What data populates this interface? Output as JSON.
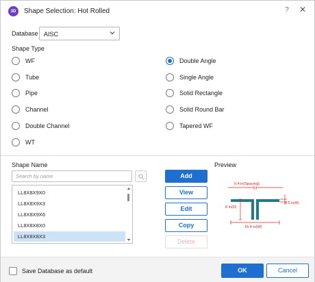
{
  "window": {
    "app_icon_text": "3D",
    "title": "Shape Selection: Hot Rolled",
    "help_label": "?",
    "close_label": "✕"
  },
  "database": {
    "label": "Database",
    "selected": "AISC"
  },
  "shape_type": {
    "label": "Shape Type",
    "options": [
      {
        "label": "WF",
        "checked": false
      },
      {
        "label": "Tube",
        "checked": false
      },
      {
        "label": "Pipe",
        "checked": false
      },
      {
        "label": "Channel",
        "checked": false
      },
      {
        "label": "Double Channel",
        "checked": false
      },
      {
        "label": "WT",
        "checked": false
      },
      {
        "label": "Double Angle",
        "checked": true
      },
      {
        "label": "Single Angle",
        "checked": false
      },
      {
        "label": "Solid Rectangle",
        "checked": false
      },
      {
        "label": "Solid Round Bar",
        "checked": false
      },
      {
        "label": "Tapered WF",
        "checked": false
      }
    ]
  },
  "shape_name": {
    "label": "Shape Name",
    "search_placeholder": "Search by name",
    "items": [
      "LL8X8X9X0",
      "LL8X8X9X3",
      "LL8X8X9X6",
      "LL8X8X8X0",
      "LL8X8X8X3"
    ],
    "selected_index": 4
  },
  "actions": {
    "add": "Add",
    "view": "View",
    "edit": "Edit",
    "copy": "Copy",
    "delete": "Delete"
  },
  "preview": {
    "label": "Preview",
    "dim_spacing": "0.4 in(Spacing)",
    "dim_d": "8 in(D)",
    "dim_tf": "0.5 in(tf)",
    "dim_w": "16.4 in(W)"
  },
  "footer": {
    "save_default_label": "Save Database as default",
    "save_default_checked": false,
    "ok": "OK",
    "cancel": "Cancel"
  },
  "colors": {
    "accent": "#1f6fd1",
    "dimension": "#e02020",
    "shape_fill": "#1e7a8c"
  }
}
